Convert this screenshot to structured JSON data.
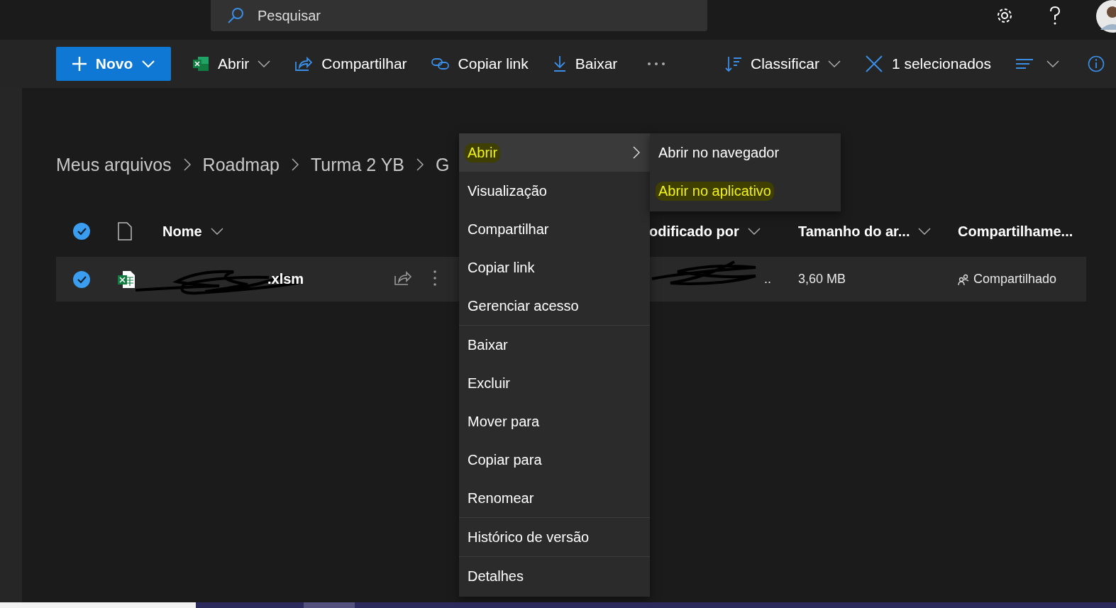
{
  "search": {
    "placeholder": "Pesquisar"
  },
  "toolbar": {
    "new_button": "Novo",
    "actions": [
      {
        "kind": "excel",
        "label": "Abrir",
        "dropdown": true
      },
      {
        "kind": "share",
        "label": "Compartilhar",
        "dropdown": false
      },
      {
        "kind": "link",
        "label": "Copiar link",
        "dropdown": false
      },
      {
        "kind": "download",
        "label": "Baixar",
        "dropdown": false
      }
    ],
    "sort": "Classificar",
    "selection": "1 selecionados"
  },
  "breadcrumb": [
    "Meus arquivos",
    "Roadmap",
    "Turma 2 YB",
    "G"
  ],
  "table": {
    "all_selected": true,
    "columns": [
      {
        "label": "Nome",
        "sortable": true
      },
      {
        "label": "odificado por",
        "sortable": true
      },
      {
        "label": "Tamanho do ar...",
        "sortable": true
      },
      {
        "label": "Compartilhame...",
        "sortable": false
      }
    ],
    "rows": [
      {
        "name": ".xlsm",
        "selected": true,
        "modified_by": "..",
        "size": "3,60 MB",
        "sharing": "Compartilhado"
      }
    ]
  },
  "context_menu": {
    "groups": [
      [
        {
          "label": "Abrir",
          "selected": true,
          "submenu": true,
          "marked": true
        },
        {
          "label": "Visualização",
          "selected": false,
          "submenu": false,
          "marked": false
        },
        {
          "label": "Compartilhar",
          "selected": false,
          "submenu": false,
          "marked": false
        },
        {
          "label": "Copiar link",
          "selected": false,
          "submenu": false,
          "marked": false
        },
        {
          "label": "Gerenciar acesso",
          "selected": false,
          "submenu": false,
          "marked": false
        }
      ],
      [
        {
          "label": "Baixar",
          "selected": false,
          "submenu": false,
          "marked": false
        },
        {
          "label": "Excluir",
          "selected": false,
          "submenu": false,
          "marked": false
        },
        {
          "label": "Mover para",
          "selected": false,
          "submenu": false,
          "marked": false
        },
        {
          "label": "Copiar para",
          "selected": false,
          "submenu": false,
          "marked": false
        },
        {
          "label": "Renomear",
          "selected": false,
          "submenu": false,
          "marked": false
        }
      ],
      [
        {
          "label": "Histórico de versão",
          "selected": false,
          "submenu": false,
          "marked": false
        }
      ],
      [
        {
          "label": "Detalhes",
          "selected": false,
          "submenu": false,
          "marked": false
        }
      ]
    ],
    "submenu": [
      {
        "label": "Abrir no navegador",
        "marked": false
      },
      {
        "label": "Abrir no aplicativo",
        "marked": true
      }
    ]
  }
}
